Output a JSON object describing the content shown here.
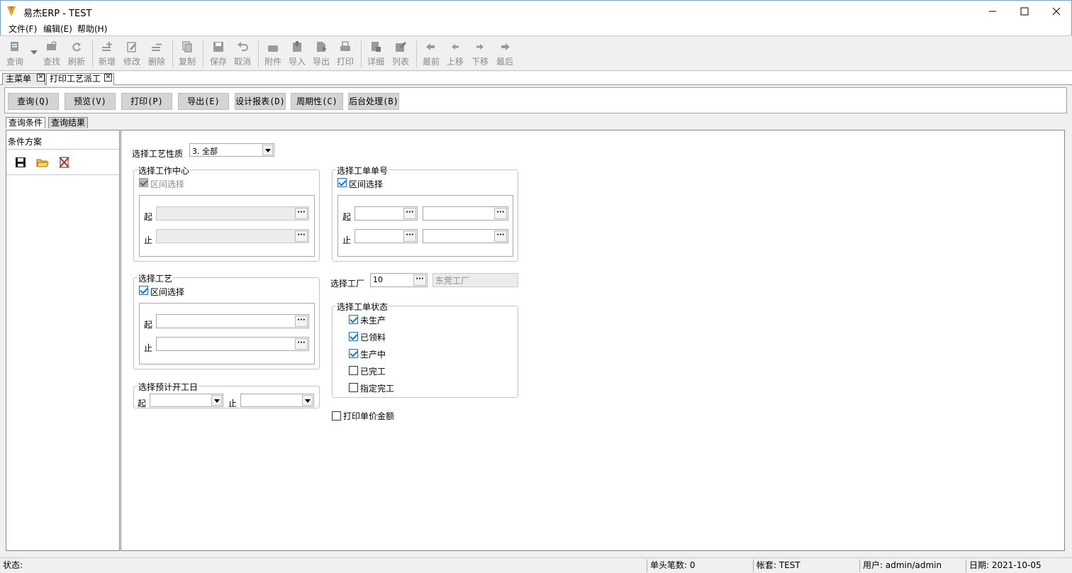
{
  "window": {
    "title": "易杰ERP - TEST"
  },
  "menu": [
    "文件(F)",
    "编辑(E)",
    "帮助(H)"
  ],
  "toolbar": [
    {
      "label": "查询",
      "icon": "query-icon"
    },
    {
      "label": "查找",
      "icon": "find-icon"
    },
    {
      "label": "刷新",
      "icon": "refresh-icon"
    },
    {
      "label": "新增",
      "icon": "add-icon"
    },
    {
      "label": "修改",
      "icon": "edit-icon"
    },
    {
      "label": "删除",
      "icon": "delete-icon"
    },
    {
      "label": "复制",
      "icon": "copy-icon"
    },
    {
      "label": "保存",
      "icon": "save-icon"
    },
    {
      "label": "取消",
      "icon": "undo-icon"
    },
    {
      "label": "附件",
      "icon": "attach-icon"
    },
    {
      "label": "导入",
      "icon": "import-icon"
    },
    {
      "label": "导出",
      "icon": "export-icon"
    },
    {
      "label": "打印",
      "icon": "print-icon"
    },
    {
      "label": "详细",
      "icon": "detail-icon"
    },
    {
      "label": "列表",
      "icon": "list-icon"
    },
    {
      "label": "最前",
      "icon": "first-icon"
    },
    {
      "label": "上移",
      "icon": "prev-icon"
    },
    {
      "label": "下移",
      "icon": "next-icon"
    },
    {
      "label": "最后",
      "icon": "last-icon"
    }
  ],
  "doc_tabs": [
    "主菜单",
    "打印工艺派工"
  ],
  "actions": [
    "查询(Q)",
    "预览(V)",
    "打印(P)",
    "导出(E)",
    "设计报表(D)",
    "周期性(C)",
    "后台处理(B)"
  ],
  "query_tabs": [
    "查询条件",
    "查询结果"
  ],
  "left_pane": {
    "title": "条件方案"
  },
  "form": {
    "process_nature_label": "选择工艺性质",
    "process_nature_value": "3. 全部",
    "work_center": {
      "title": "选择工作中心",
      "range_label": "区间选择",
      "range_checked": true,
      "range_disabled": true,
      "from": "起",
      "to": "止"
    },
    "work_order": {
      "title": "选择工单单号",
      "range_label": "区间选择",
      "range_checked": true,
      "from": "起",
      "to": "止"
    },
    "process": {
      "title": "选择工艺",
      "range_label": "区间选择",
      "range_checked": true,
      "from": "起",
      "to": "止"
    },
    "factory": {
      "label": "选择工厂",
      "code": "10",
      "name": "东莞工厂"
    },
    "order_status": {
      "title": "选择工单状态",
      "items": [
        {
          "label": "未生产",
          "checked": true
        },
        {
          "label": "已领料",
          "checked": true
        },
        {
          "label": "生产中",
          "checked": true
        },
        {
          "label": "已完工",
          "checked": false
        },
        {
          "label": "指定完工",
          "checked": false
        }
      ]
    },
    "start_date": {
      "title": "选择预计开工日",
      "from": "起",
      "to": "止"
    },
    "print_price": {
      "label": "打印单价金额",
      "checked": false
    }
  },
  "status": {
    "state": "状态:",
    "count": "单头笔数: 0",
    "account": "帐套: TEST",
    "user": "用户: admin/admin",
    "date": "日期: 2021-10-05"
  }
}
